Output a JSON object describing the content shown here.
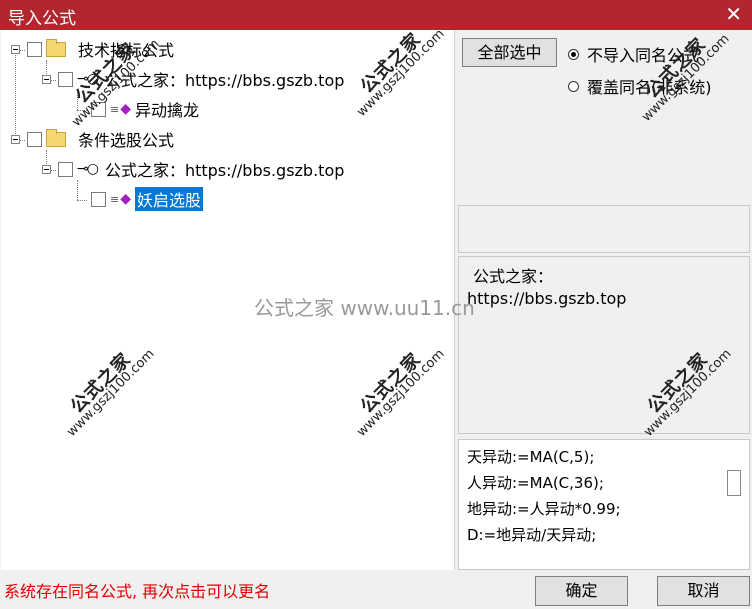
{
  "window": {
    "title": "导入公式",
    "close_glyph": "✕"
  },
  "tree": {
    "nodes": [
      {
        "label": "技术指标公式",
        "level": 0
      },
      {
        "label": "公式之家：https://bbs.gszb.top",
        "level": 1
      },
      {
        "label": "异动擒龙",
        "level": 2
      },
      {
        "label": "条件选股公式",
        "level": 0
      },
      {
        "label": "公式之家：https://bbs.gszb.top",
        "level": 1
      },
      {
        "label": "妖启选股",
        "level": 2,
        "selected": true
      }
    ]
  },
  "controls": {
    "select_all": "全部选中",
    "radio_no_import": "不导入同名公式",
    "radio_overwrite": "覆盖同名(非系统)"
  },
  "info": {
    "line1": "公式之家：",
    "line2": "https://bbs.gszb.top"
  },
  "code": [
    "天异动:=MA(C,5);",
    "人异动:=MA(C,36);",
    "地异动:=人异动*0.99;",
    "D:=地异动/天异动;"
  ],
  "footer": {
    "status": "系统存在同名公式, 再次点击可以更名",
    "ok": "确定",
    "cancel": "取消"
  },
  "watermark": {
    "center": "公式之家 www.uu11.cn",
    "stamp_title": "公式之家",
    "stamp_url": "www.gszj100.com"
  },
  "colors": {
    "titlebar": "#b3262e",
    "selection": "#0078d7",
    "status": "#e00000"
  }
}
